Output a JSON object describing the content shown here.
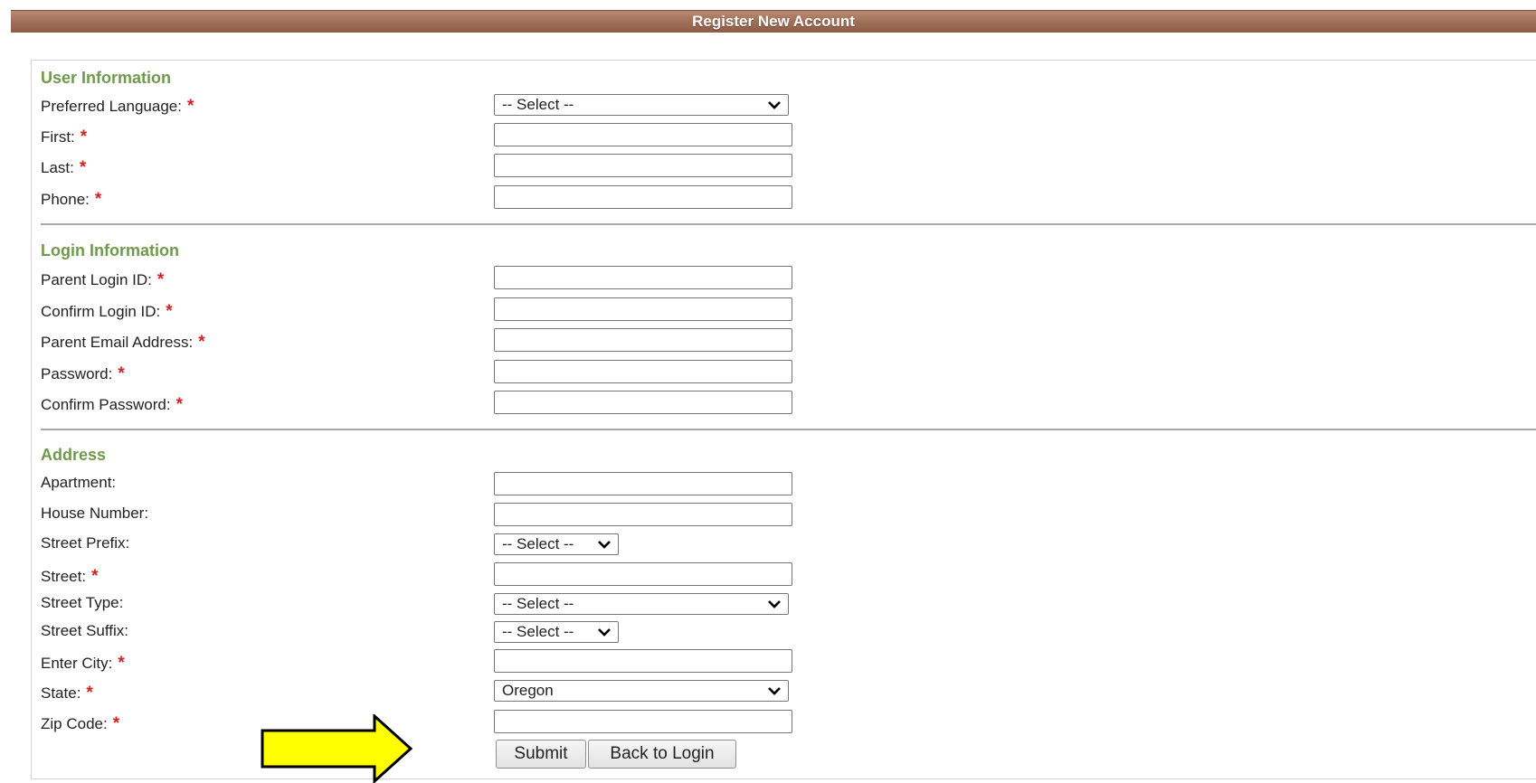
{
  "page": {
    "title": "Register New Account"
  },
  "required_marker": "*",
  "sections": {
    "user": {
      "title": "User Information",
      "preferred_language": {
        "label": "Preferred Language:",
        "selected": "-- Select --"
      },
      "first": {
        "label": "First:",
        "value": ""
      },
      "last": {
        "label": "Last:",
        "value": ""
      },
      "phone": {
        "label": "Phone:",
        "value": ""
      }
    },
    "login": {
      "title": "Login Information",
      "parent_login_id": {
        "label": "Parent Login ID:",
        "value": ""
      },
      "confirm_login_id": {
        "label": "Confirm Login ID:",
        "value": ""
      },
      "parent_email": {
        "label": "Parent Email Address:",
        "value": ""
      },
      "password": {
        "label": "Password:",
        "value": ""
      },
      "confirm_password": {
        "label": "Confirm Password:",
        "value": ""
      }
    },
    "address": {
      "title": "Address",
      "apartment": {
        "label": "Apartment:",
        "value": ""
      },
      "house_number": {
        "label": "House Number:",
        "value": ""
      },
      "street_prefix": {
        "label": "Street Prefix:",
        "selected": "-- Select --"
      },
      "street": {
        "label": "Street:",
        "value": ""
      },
      "street_type": {
        "label": "Street Type:",
        "selected": "-- Select --"
      },
      "street_suffix": {
        "label": "Street Suffix:",
        "selected": "-- Select --"
      },
      "city": {
        "label": "Enter City:",
        "value": ""
      },
      "state": {
        "label": "State:",
        "selected": "Oregon"
      },
      "zip": {
        "label": "Zip Code:",
        "value": ""
      }
    }
  },
  "buttons": {
    "submit": "Submit",
    "back": "Back to Login"
  },
  "colors": {
    "title_bar": "#a2715a",
    "section_title": "#6f9a4c",
    "required": "#d42121",
    "annotation_arrow_fill": "#ffff00"
  },
  "annotation": {
    "icon": "right-arrow-icon"
  }
}
